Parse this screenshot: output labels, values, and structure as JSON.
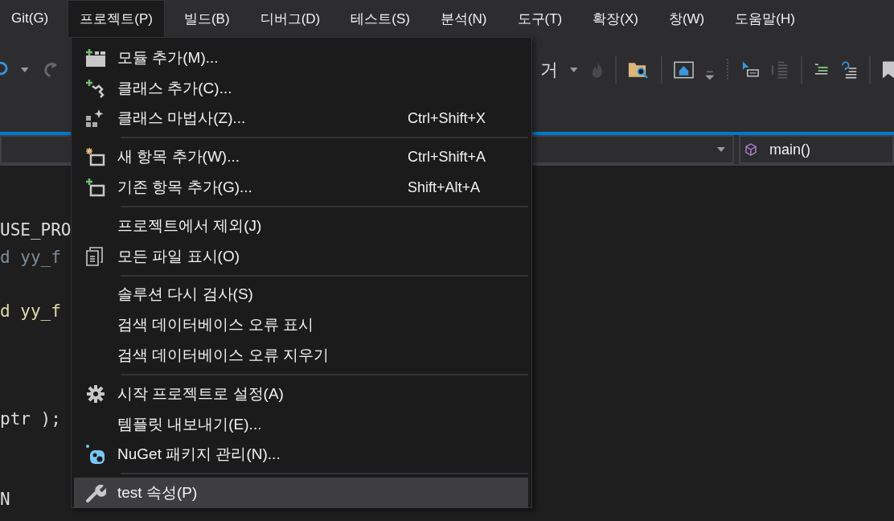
{
  "menubar": [
    {
      "label": "Git(G)",
      "selected": false
    },
    {
      "label": "프로젝트(P)",
      "selected": true
    },
    {
      "label": "빌드(B)",
      "selected": false
    },
    {
      "label": "디버그(D)",
      "selected": false
    },
    {
      "label": "테스트(S)",
      "selected": false
    },
    {
      "label": "분석(N)",
      "selected": false
    },
    {
      "label": "도구(T)",
      "selected": false
    },
    {
      "label": "확장(X)",
      "selected": false
    },
    {
      "label": "창(W)",
      "selected": false
    },
    {
      "label": "도움말(H)",
      "selected": false
    }
  ],
  "toolbar": {
    "partial_label": "거"
  },
  "navigation_bar": {
    "member": "main()"
  },
  "code_lines": [
    {
      "text": "USE_PRO",
      "kind": "plain"
    },
    {
      "text": "d yy_f",
      "kind": "dim"
    },
    {
      "kind": "blank"
    },
    {
      "text": "d yy_f",
      "kind": "call"
    },
    {
      "kind": "blank"
    },
    {
      "kind": "blank"
    },
    {
      "kind": "blank"
    },
    {
      "text": "ptr );",
      "kind": "plain"
    },
    {
      "kind": "blank"
    },
    {
      "kind": "blank"
    },
    {
      "text": "N",
      "kind": "plain"
    }
  ],
  "menu": {
    "items": [
      {
        "kind": "item",
        "label": "모듈 추가(M)...",
        "selected": false
      },
      {
        "kind": "item",
        "label": "클래스 추가(C)...",
        "selected": false
      },
      {
        "kind": "item",
        "label": "클래스 마법사(Z)...",
        "shortcut": "Ctrl+Shift+X",
        "selected": false
      },
      {
        "kind": "separator"
      },
      {
        "kind": "item",
        "label": "새 항목 추가(W)...",
        "shortcut": "Ctrl+Shift+A",
        "selected": false
      },
      {
        "kind": "item",
        "label": "기존 항목 추가(G)...",
        "shortcut": "Shift+Alt+A",
        "selected": false
      },
      {
        "kind": "separator"
      },
      {
        "kind": "item",
        "label": "프로젝트에서 제외(J)",
        "selected": false
      },
      {
        "kind": "item",
        "label": "모든 파일 표시(O)",
        "selected": false
      },
      {
        "kind": "separator"
      },
      {
        "kind": "item",
        "label": "솔루션 다시 검사(S)",
        "selected": false
      },
      {
        "kind": "item",
        "label": "검색 데이터베이스 오류 표시",
        "selected": false
      },
      {
        "kind": "item",
        "label": "검색 데이터베이스 오류 지우기",
        "selected": false
      },
      {
        "kind": "separator"
      },
      {
        "kind": "item",
        "label": "시작 프로젝트로 설정(A)",
        "selected": false
      },
      {
        "kind": "item",
        "label": "템플릿 내보내기(E)...",
        "selected": false
      },
      {
        "kind": "item",
        "label": "NuGet 패키지 관리(N)...",
        "selected": false
      },
      {
        "kind": "separator"
      },
      {
        "kind": "item",
        "label": "test 속성(P)",
        "selected": true
      }
    ]
  }
}
